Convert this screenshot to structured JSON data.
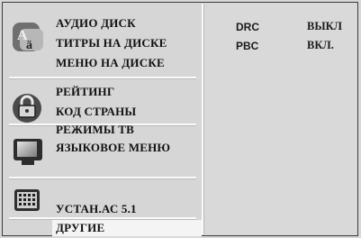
{
  "menu": {
    "group1": {
      "icon": "language-icon",
      "items": [
        "АУДИО ДИСК",
        "ТИТРЫ НА ДИСКЕ",
        "МЕНЮ НА ДИСКЕ"
      ]
    },
    "group2": {
      "icon": "lock-icon",
      "items": [
        "РЕЙТИНГ",
        "КОД СТРАНЫ"
      ]
    },
    "group3": {
      "icon": "tv-icon",
      "items": [
        "РЕЖИМЫ ТВ",
        "ЯЗЫКОВОЕ МЕНЮ"
      ]
    },
    "group4": {
      "icon": "speaker-icon",
      "items": [
        "УСТАН.АС 5.1"
      ]
    },
    "group5": {
      "items": [
        "ДРУГИЕ"
      ]
    }
  },
  "settings": [
    {
      "name": "DRC",
      "value": "ВЫКЛ"
    },
    {
      "name": "PBC",
      "value": "ВКЛ."
    }
  ]
}
